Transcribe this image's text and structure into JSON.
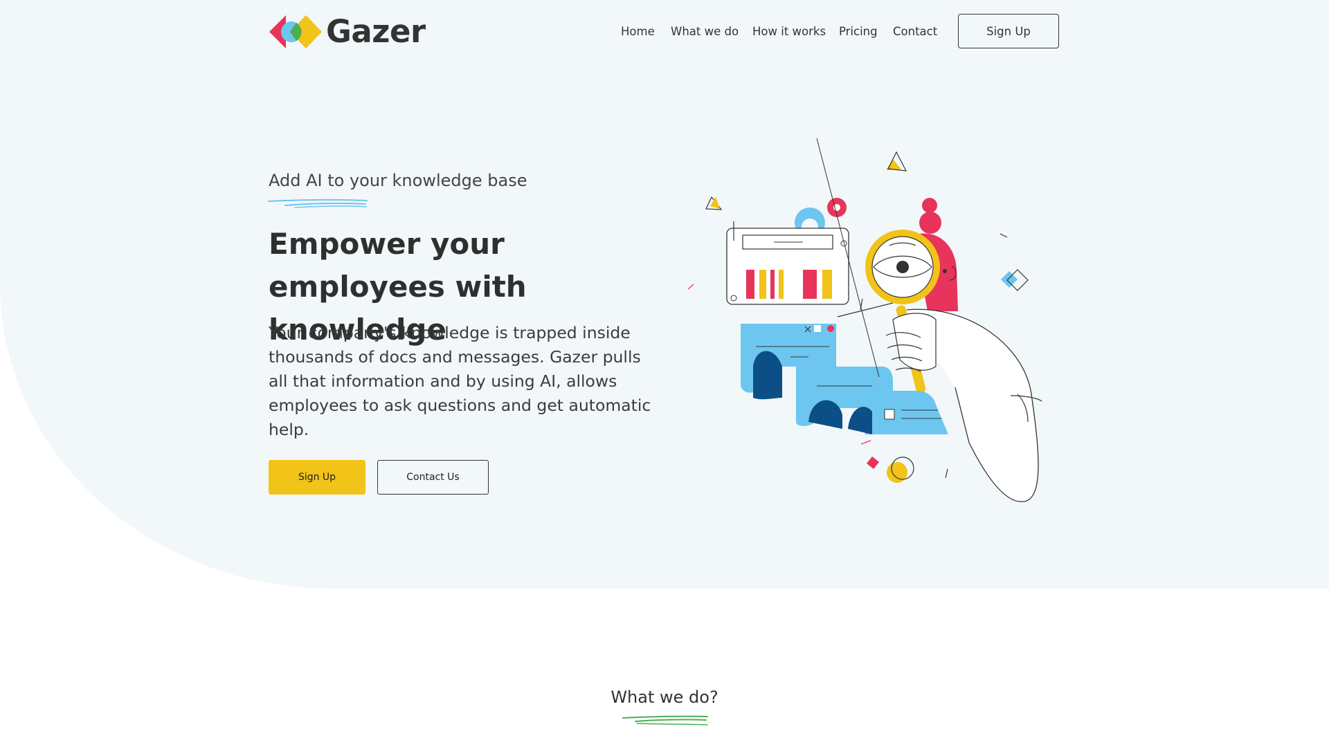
{
  "brand": {
    "name": "Gazer",
    "colors": {
      "red": "#e8345a",
      "yellow": "#f2c318",
      "blue": "#6cc6ef",
      "green": "#4caf50",
      "navy": "#0b4f86"
    }
  },
  "nav": {
    "items": [
      {
        "label": "Home"
      },
      {
        "label": "What we do"
      },
      {
        "label": "How it works"
      },
      {
        "label": "Pricing"
      },
      {
        "label": "Contact"
      }
    ],
    "signup_label": "Sign Up"
  },
  "hero": {
    "eyebrow": "Add AI to your knowledge base",
    "headline": "Empower your employees with knowledge",
    "description": "Your company's knowledge is trapped inside thousands of docs and messages. Gazer pulls all that information and by using AI, allows employees to ask questions and get automatic help.",
    "primary_button": "Sign Up",
    "secondary_button": "Contact Us"
  },
  "section": {
    "title": "What we do?"
  }
}
